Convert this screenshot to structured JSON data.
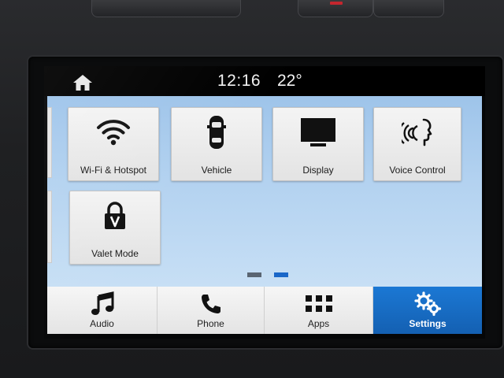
{
  "status_bar": {
    "time": "12:16",
    "temperature": "22°",
    "home_icon": "home-icon"
  },
  "tiles": [
    {
      "label": "Wi-Fi & Hotspot",
      "icon": "wifi-icon"
    },
    {
      "label": "Vehicle",
      "icon": "car-icon"
    },
    {
      "label": "Display",
      "icon": "monitor-icon"
    },
    {
      "label": "Voice Control",
      "icon": "voice-icon"
    },
    {
      "label": "Valet Mode",
      "icon": "lock-icon"
    }
  ],
  "pager": {
    "current_page": 2,
    "total_pages": 2
  },
  "bottom_nav": [
    {
      "label": "Audio",
      "icon": "music-note-icon",
      "active": false
    },
    {
      "label": "Phone",
      "icon": "phone-icon",
      "active": false
    },
    {
      "label": "Apps",
      "icon": "grid-icon",
      "active": false
    },
    {
      "label": "Settings",
      "icon": "gears-icon",
      "active": true
    }
  ],
  "colors": {
    "active_tab": "#1b78d4",
    "pager_active": "#1a67c8",
    "pager_inactive": "#5a6572",
    "background_blue": "#b3d2f0"
  }
}
